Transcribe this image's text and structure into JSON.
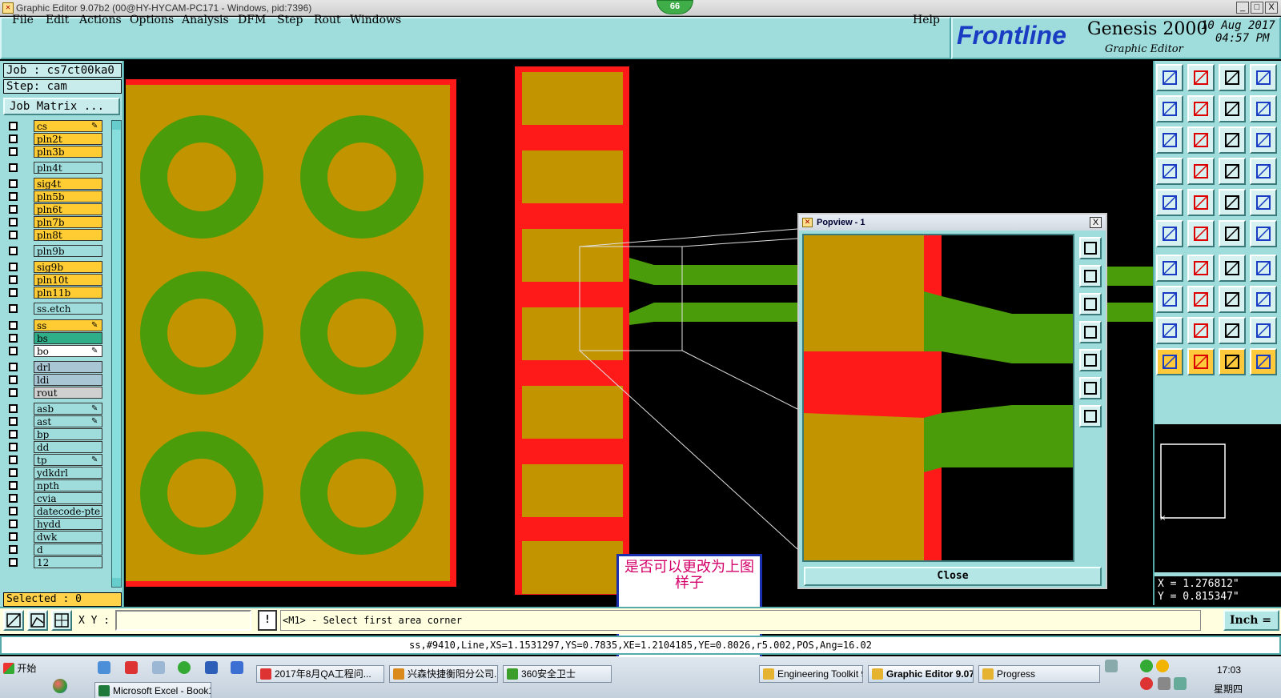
{
  "window": {
    "title": "Graphic Editor 9.07b2 (00@HY-HYCAM-PC171 - Windows, pid:7396)",
    "badge": "66",
    "minimize": "_",
    "maximize": "□",
    "close": "X"
  },
  "menu": {
    "items": [
      "File",
      "Edit",
      "Actions",
      "Options",
      "Analysis",
      "DFM",
      "Step",
      "Rout",
      "Windows"
    ],
    "help": "Help"
  },
  "brand": {
    "logo": "Frontline",
    "product": "Genesis 2000",
    "subtitle": "Graphic Editor",
    "date": "10 Aug 2017",
    "time": "04:57 PM"
  },
  "job": {
    "job_line": "Job : cs7ct00ka0",
    "step_line": "Step: cam",
    "matrix_button": "Job Matrix ...",
    "selected": "Selected : 0"
  },
  "layers": [
    {
      "name": "cs",
      "color": "#ffcc33",
      "flag": "✎"
    },
    {
      "name": "pln2t",
      "color": "#ffcc33",
      "flag": ""
    },
    {
      "name": "pln3b",
      "color": "#ffcc33",
      "flag": ""
    },
    {
      "name": "pln4t",
      "color": "#9fdcdc",
      "flag": ""
    },
    {
      "name": "sig4t",
      "color": "#ffcc33",
      "flag": ""
    },
    {
      "name": "pln5b",
      "color": "#ffcc33",
      "flag": ""
    },
    {
      "name": "pln6t",
      "color": "#ffcc33",
      "flag": ""
    },
    {
      "name": "pln7b",
      "color": "#ffcc33",
      "flag": ""
    },
    {
      "name": "pln8t",
      "color": "#ffcc33",
      "flag": ""
    },
    {
      "name": "pln9b",
      "color": "#9fdcdc",
      "flag": ""
    },
    {
      "name": "sig9b",
      "color": "#ffcc33",
      "flag": ""
    },
    {
      "name": "pln10t",
      "color": "#ffcc33",
      "flag": ""
    },
    {
      "name": "pln11b",
      "color": "#ffcc33",
      "flag": ""
    },
    {
      "name": "ss.etch",
      "color": "#9fdcdc",
      "flag": ""
    },
    {
      "name": "ss",
      "color": "#ffcc33",
      "flag": "✎"
    },
    {
      "name": "bs",
      "color": "#2fae8a",
      "flag": ""
    },
    {
      "name": "bo",
      "color": "#ffffff",
      "flag": "✎"
    },
    {
      "name": "drl",
      "color": "#a9c6d4",
      "flag": ""
    },
    {
      "name": "ldi",
      "color": "#a9c6d4",
      "flag": ""
    },
    {
      "name": "rout",
      "color": "#d0d0d0",
      "flag": ""
    },
    {
      "name": "asb",
      "color": "#9fdcdc",
      "flag": "✎"
    },
    {
      "name": "ast",
      "color": "#9fdcdc",
      "flag": "✎"
    },
    {
      "name": "bp",
      "color": "#9fdcdc",
      "flag": ""
    },
    {
      "name": "dd",
      "color": "#9fdcdc",
      "flag": ""
    },
    {
      "name": "tp",
      "color": "#9fdcdc",
      "flag": "✎"
    },
    {
      "name": "ydkdrl",
      "color": "#9fdcdc",
      "flag": ""
    },
    {
      "name": "npth",
      "color": "#9fdcdc",
      "flag": ""
    },
    {
      "name": "cvia",
      "color": "#9fdcdc",
      "flag": ""
    },
    {
      "name": "datecode-pte",
      "color": "#9fdcdc",
      "flag": ""
    },
    {
      "name": "hydd",
      "color": "#9fdcdc",
      "flag": ""
    },
    {
      "name": "dwk",
      "color": "#9fdcdc",
      "flag": ""
    },
    {
      "name": "d",
      "color": "#9fdcdc",
      "flag": ""
    },
    {
      "name": "12",
      "color": "#9fdcdc",
      "flag": ""
    }
  ],
  "popview": {
    "title": "Popview - 1",
    "close_label": "Close",
    "close_x": "X"
  },
  "note": {
    "text": "是否可以更改为上图样子"
  },
  "command": {
    "xy_label": "X Y :",
    "xy_value": "",
    "warn": "!",
    "prompt": "<M1> - Select first area corner",
    "units": "Inch ="
  },
  "status": {
    "text": "ss,#9410,Line,XS=1.1531297,YS=0.7835,XE=1.2104185,YE=0.8026,r5.002,POS,Ang=16.02"
  },
  "coords": {
    "x": "X = 1.276812\"",
    "y": "Y = 0.815347\""
  },
  "taskbar": {
    "start": "开始",
    "tasks_row1": [
      {
        "label": "2017年8月QA工程问...",
        "color": "#d33"
      },
      {
        "label": "兴森快捷衡阳分公司...",
        "color": "#d98a1a"
      },
      {
        "label": "360安全卫士",
        "color": "#3b9d2a"
      },
      {
        "label": "Engineering Toolkit 9.0...",
        "color": "#e5b330"
      },
      {
        "label": "Graphic Editor 9.07b...",
        "color": "#e5b330"
      },
      {
        "label": "Progress",
        "color": "#e5b330"
      }
    ],
    "tasks_row2": [
      {
        "label": "Microsoft Excel - Book1",
        "color": "#1e7a3a"
      }
    ],
    "clock_time": "17:03",
    "clock_day": "星期四"
  },
  "colors": {
    "panel": "#9fdcdc",
    "copper": "#c29500",
    "mask": "#ff1a1a",
    "trace": "#4b9c0a"
  }
}
